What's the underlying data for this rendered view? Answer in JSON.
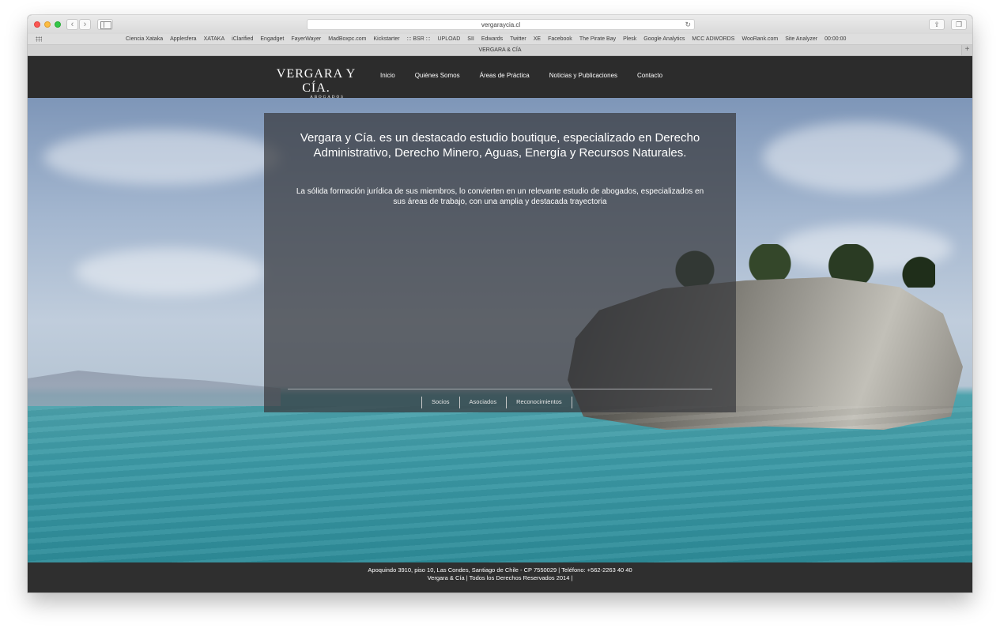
{
  "browser": {
    "url": "vergaraycia.cl",
    "tab_title": "VERGARA & CÍA",
    "bookmarks": [
      "Ciencia Xataka",
      "Applesfera",
      "XATAKA",
      "iClarified",
      "Engadget",
      "FayerWayer",
      "MadBoxpc.com",
      "Kickstarter",
      "::: BSR :::",
      "UPLOAD",
      "SII",
      "Edwards",
      "Twitter",
      "XE",
      "Facebook",
      "The Pirate Bay",
      "Plesk",
      "Google Analytics",
      "MCC ADWORDS",
      "WooRank.com",
      "Site Analyzer",
      "00:00:00"
    ],
    "icons": {
      "back": "‹",
      "forward": "›",
      "reload": "↻",
      "share": "⇪",
      "tabs": "❐",
      "new_tab": "+"
    }
  },
  "site": {
    "logo": {
      "name": "VERGARA Y CÍA.",
      "subtitle": "ABOGADOS"
    },
    "nav": [
      "Inicio",
      "Quiénes Somos",
      "Áreas de Práctica",
      "Noticias y Publicaciones",
      "Contacto"
    ],
    "hero": {
      "headline": "Vergara y Cía. es un destacado estudio boutique, especializado en Derecho Administrativo, Derecho Minero, Aguas, Energía y Recursos Naturales.",
      "subtext": "La sólida formación jurídica de sus miembros, lo convierten en un relevante estudio de abogados, especializados en sus áreas de trabajo, con una amplia y destacada trayectoria",
      "sub_nav": [
        "Socios",
        "Asociados",
        "Reconocimientos"
      ]
    },
    "footer": {
      "address": "Apoquindo 3910, piso 10, Las Condes, Santiago de Chile - CP 7550029 | Teléfono: +562-2263 40 40",
      "copyright": "Vergara & Cía | Todos los Derechos Reservados 2014 |"
    }
  },
  "colors": {
    "header_bg": "#2c2c2c",
    "overlay_bg": "#37393d",
    "footer_bg": "#2f2f2f"
  }
}
